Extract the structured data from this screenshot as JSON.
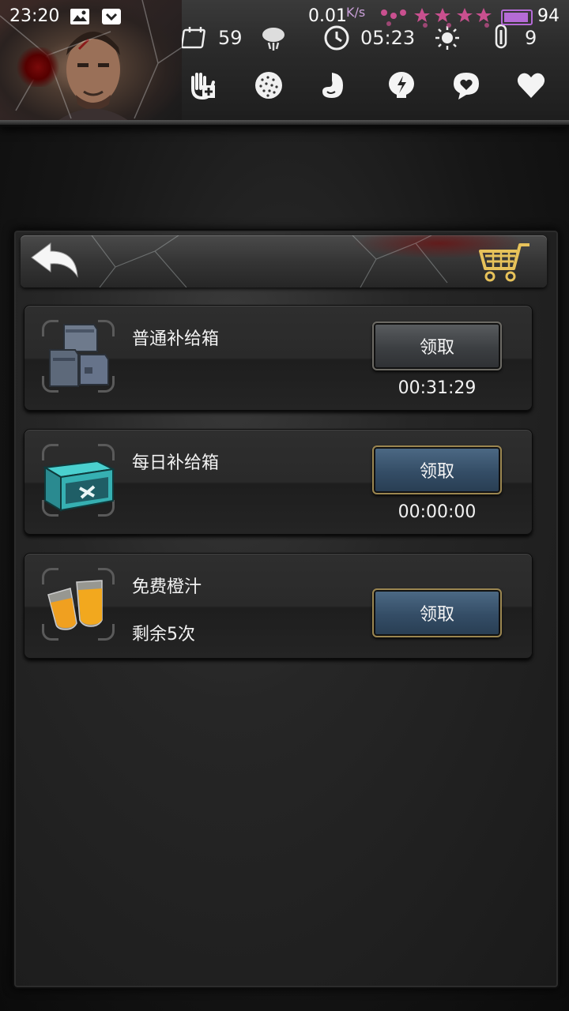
{
  "status_bar": {
    "time": "23:20",
    "net_speed": "0.01",
    "net_speed_unit": "K/s",
    "battery_level": "94",
    "battery_fraction": 0.94
  },
  "hud": {
    "days_label": "59",
    "clock_label": "05:23",
    "temperature_label": "9",
    "icons": [
      "calendar-icon",
      "weather-icon",
      "clock-icon",
      "sun-icon",
      "thermometer-icon"
    ],
    "needs": [
      "health-icon",
      "infection-icon",
      "hunger-icon",
      "energy-icon",
      "mood-icon",
      "heart-icon"
    ]
  },
  "toolbar": {
    "back_icon": "back-arrow-icon",
    "shop_icon": "shopping-cart-icon"
  },
  "rows": [
    {
      "title": "普通补给箱",
      "subtitle": "",
      "button_label": "领取",
      "button_style": "gray",
      "timer": "00:31:29",
      "icon": "ammo-crates-icon"
    },
    {
      "title": "每日补给箱",
      "subtitle": "",
      "button_label": "领取",
      "button_style": "blue",
      "timer": "00:00:00",
      "icon": "supply-chest-icon"
    },
    {
      "title": "免费橙汁",
      "subtitle": "剩余5次",
      "button_label": "领取",
      "button_style": "blue",
      "timer": "",
      "icon": "orange-juice-icon"
    }
  ],
  "colors": {
    "accent_purple": "#b56bd6",
    "button_blue": "#344d66",
    "button_gray": "#3c3f42",
    "button_border_gold": "#9b8650"
  }
}
